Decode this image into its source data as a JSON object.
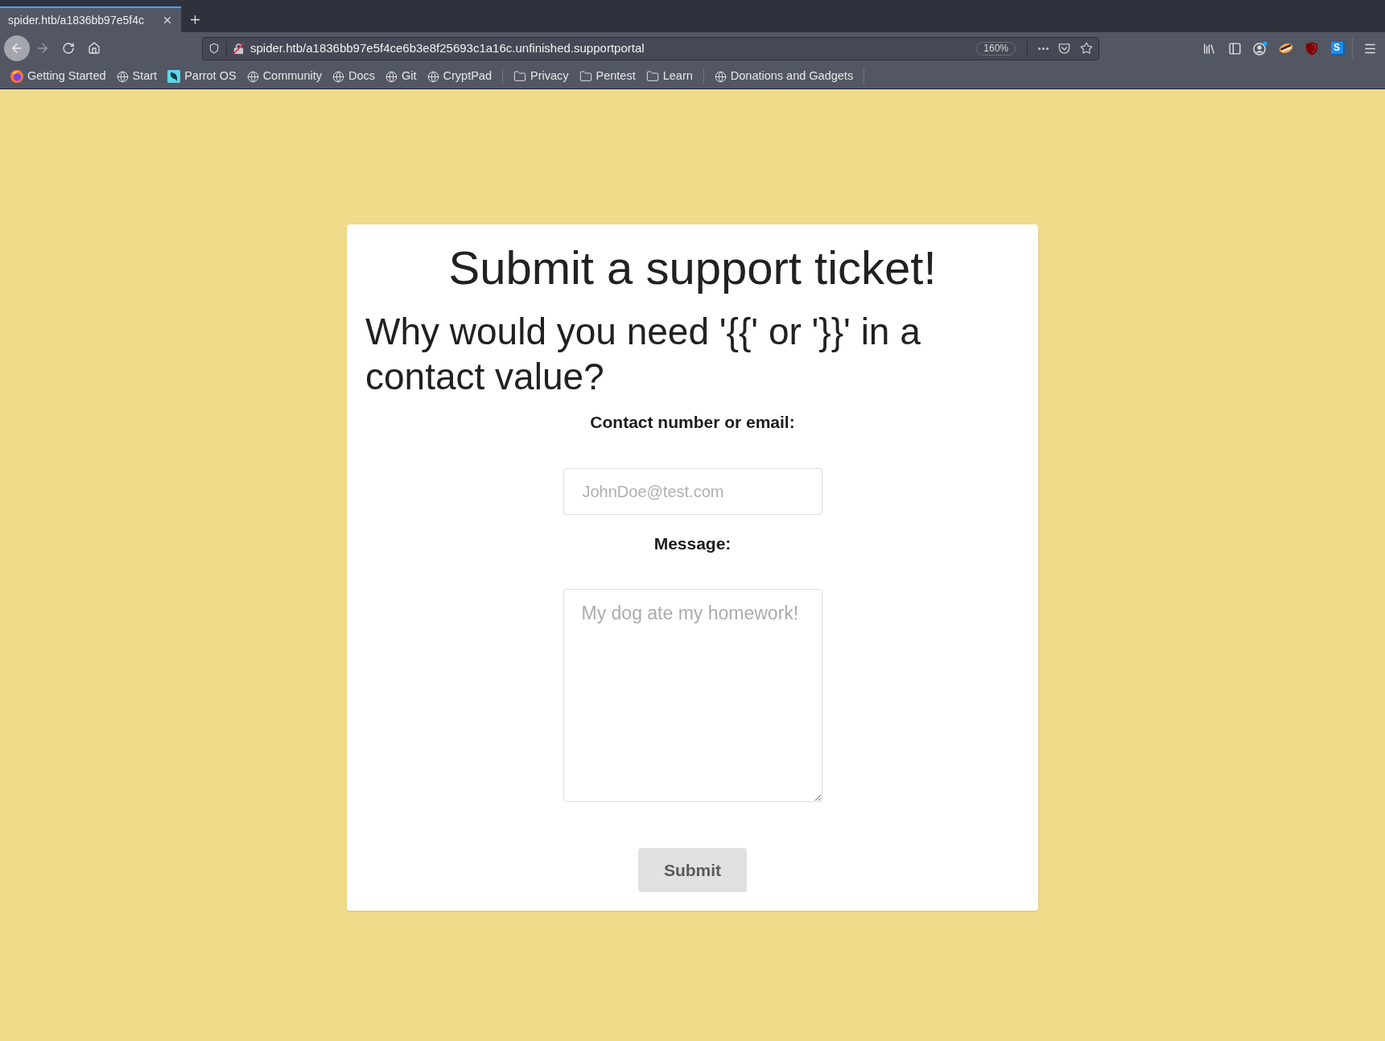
{
  "browser": {
    "tabs": [
      {
        "title": "spider.htb/a1836bb97e5f4c",
        "selected": true
      }
    ],
    "nav": {
      "back": {
        "disabled": false
      },
      "forward": {
        "disabled": true
      }
    },
    "address_bar": {
      "url": "spider.htb/a1836bb97e5f4ce6b3e8f25693c1a16c.unfinished.supportportal",
      "zoom": "160%"
    },
    "extension_label": "S",
    "bookmarks": [
      {
        "kind": "firefox",
        "label": "Getting Started"
      },
      {
        "kind": "globe",
        "label": "Start"
      },
      {
        "kind": "parrot",
        "label": "Parrot OS"
      },
      {
        "kind": "globe",
        "label": "Community"
      },
      {
        "kind": "globe",
        "label": "Docs"
      },
      {
        "kind": "globe",
        "label": "Git"
      },
      {
        "kind": "globe",
        "label": "CryptPad"
      },
      {
        "kind": "separator"
      },
      {
        "kind": "folder",
        "label": "Privacy"
      },
      {
        "kind": "folder",
        "label": "Pentest"
      },
      {
        "kind": "folder",
        "label": "Learn"
      },
      {
        "kind": "separator"
      },
      {
        "kind": "globe",
        "label": "Donations and Gadgets"
      },
      {
        "kind": "separator"
      }
    ]
  },
  "form": {
    "title": "Submit a support ticket!",
    "subtitle": "Why would you need '{{' or '}}' in a contact value?",
    "fields": [
      {
        "kind": "input",
        "label": "Contact number or email:",
        "placeholder": "JohnDoe@test.com"
      },
      {
        "kind": "textarea",
        "label": "Message:",
        "placeholder": "My dog ate my homework!"
      }
    ],
    "submit": "Submit"
  }
}
